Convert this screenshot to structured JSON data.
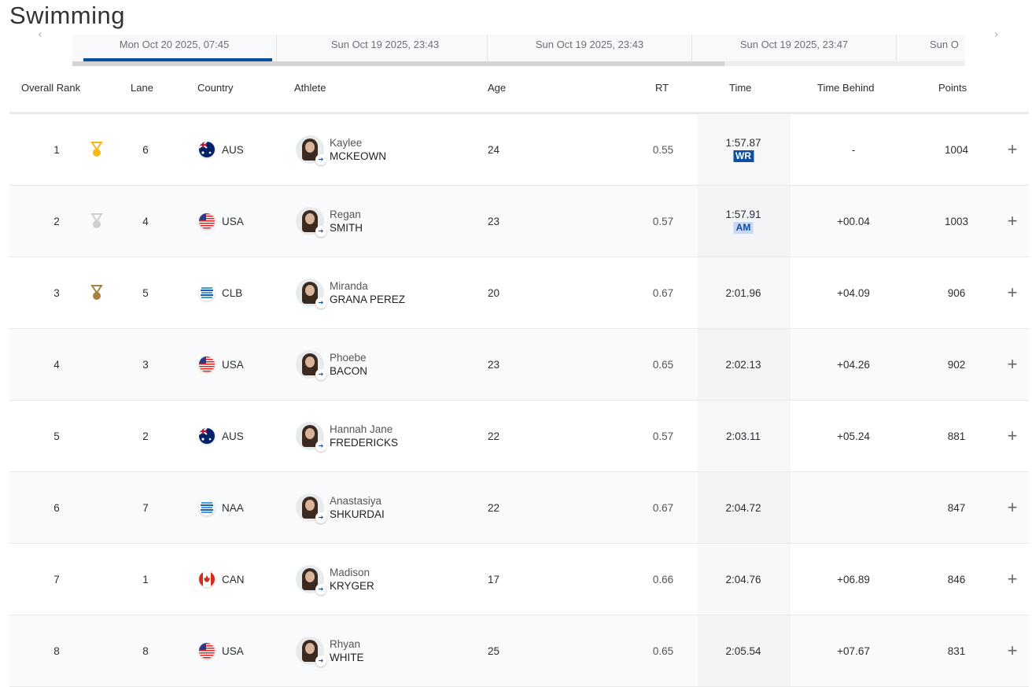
{
  "title": "Swimming",
  "tabs": [
    "Mon Oct 20 2025, 07:45",
    "Sun Oct 19 2025, 23:43",
    "Sun Oct 19 2025, 23:43",
    "Sun Oct 19 2025, 23:47",
    "Sun O"
  ],
  "active_tab": 0,
  "scroll_fraction": 0.73,
  "headers": {
    "rank": "Overall Rank",
    "lane": "Lane",
    "country": "Country",
    "athlete": "Athlete",
    "age": "Age",
    "rt": "RT",
    "time": "Time",
    "behind": "Time Behind",
    "points": "Points"
  },
  "colors": {
    "accent": "#0b4ea2",
    "gold": "#f6b818",
    "silver": "#cfcfcf",
    "bronze": "#a5803e"
  },
  "rows": [
    {
      "rank": "1",
      "medal": "gold",
      "lane": "6",
      "country": "AUS",
      "first": "Kaylee",
      "last": "MCKEOWN",
      "age": "24",
      "rt": "0.55",
      "time": "1:57.87",
      "badge": "WR",
      "behind": "-",
      "points": "1004"
    },
    {
      "rank": "2",
      "medal": "silver",
      "lane": "4",
      "country": "USA",
      "first": "Regan",
      "last": "SMITH",
      "age": "23",
      "rt": "0.57",
      "time": "1:57.91",
      "badge": "AM",
      "behind": "+00.04",
      "points": "1003"
    },
    {
      "rank": "3",
      "medal": "bronze",
      "lane": "5",
      "country": "CLB",
      "first": "Miranda",
      "last": "GRANA PEREZ",
      "age": "20",
      "rt": "0.67",
      "time": "2:01.96",
      "badge": "",
      "behind": "+04.09",
      "points": "906"
    },
    {
      "rank": "4",
      "medal": "",
      "lane": "3",
      "country": "USA",
      "first": "Phoebe",
      "last": "BACON",
      "age": "23",
      "rt": "0.65",
      "time": "2:02.13",
      "badge": "",
      "behind": "+04.26",
      "points": "902"
    },
    {
      "rank": "5",
      "medal": "",
      "lane": "2",
      "country": "AUS",
      "first": "Hannah Jane",
      "last": "FREDERICKS",
      "age": "22",
      "rt": "0.57",
      "time": "2:03.11",
      "badge": "",
      "behind": "+05.24",
      "points": "881"
    },
    {
      "rank": "6",
      "medal": "",
      "lane": "7",
      "country": "NAA",
      "first": "Anastasiya",
      "last": "SHKURDAI",
      "age": "22",
      "rt": "0.67",
      "time": "2:04.72",
      "badge": "",
      "behind": "",
      "points": "847"
    },
    {
      "rank": "7",
      "medal": "",
      "lane": "1",
      "country": "CAN",
      "first": "Madison",
      "last": "KRYGER",
      "age": "17",
      "rt": "0.66",
      "time": "2:04.76",
      "badge": "",
      "behind": "+06.89",
      "points": "846"
    },
    {
      "rank": "8",
      "medal": "",
      "lane": "8",
      "country": "USA",
      "first": "Rhyan",
      "last": "WHITE",
      "age": "25",
      "rt": "0.65",
      "time": "2:05.54",
      "badge": "",
      "behind": "+07.67",
      "points": "831"
    }
  ]
}
